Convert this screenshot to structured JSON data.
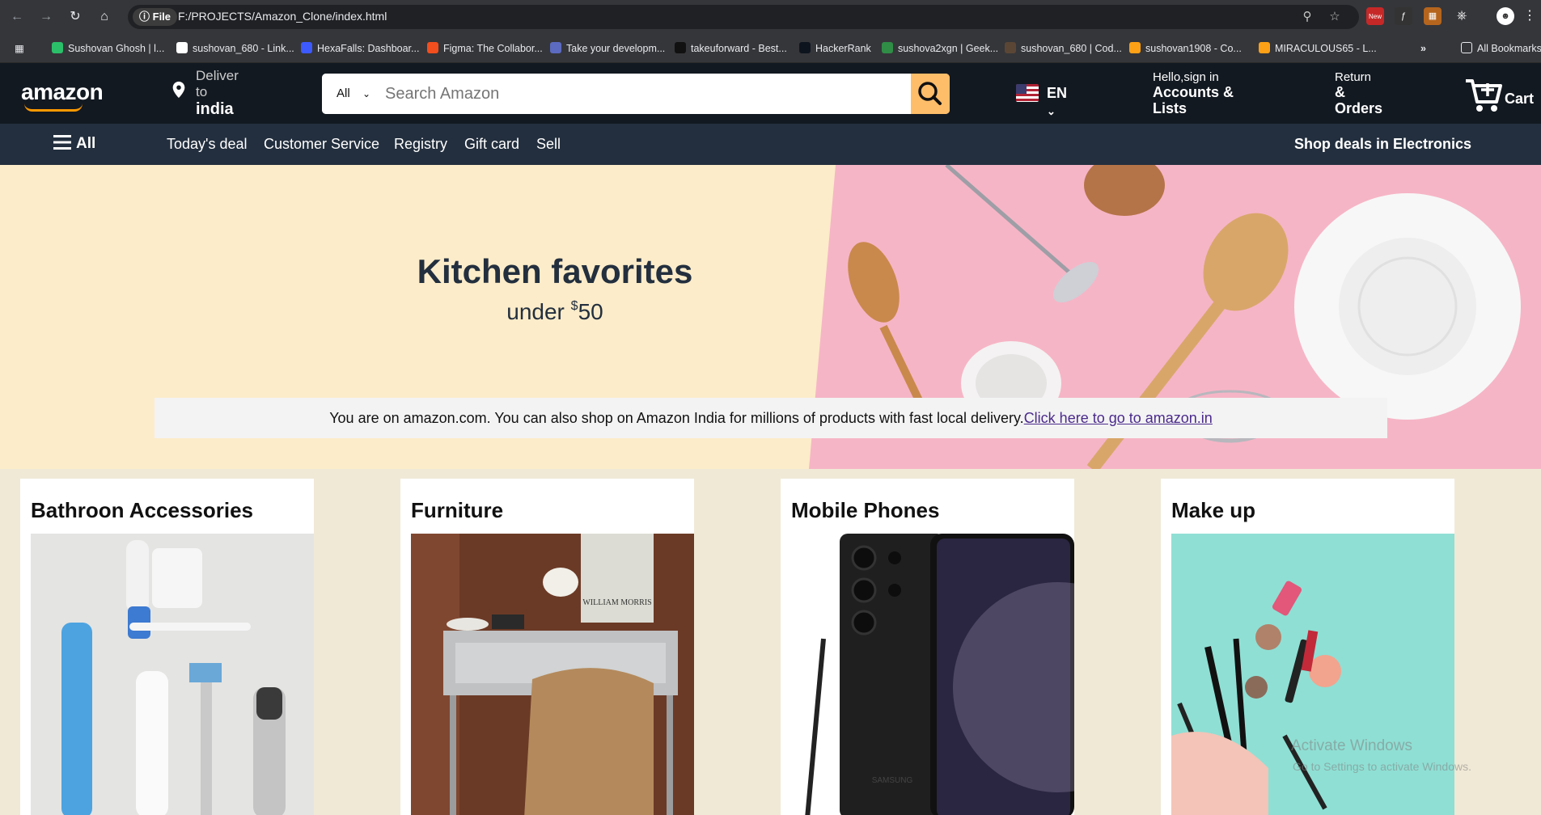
{
  "browser": {
    "file_chip": "File",
    "url": "F:/PROJECTS/Amazon_Clone/index.html",
    "bookmarks": [
      "Sushovan Ghosh | l...",
      "sushovan_680 - Link...",
      "HexaFalls: Dashboar...",
      "Figma: The Collabor...",
      "Take your developm...",
      "takeuforward - Best...",
      "HackerRank",
      "sushova2xgn | Geek...",
      "sushovan_680 | Cod...",
      "sushovan1908 - Co...",
      "MIRACULOUS65 - L..."
    ],
    "all_bookmarks": "All Bookmarks",
    "ext_badge": "New"
  },
  "header": {
    "logo": "amazon",
    "deliver_line1": "Deliver",
    "deliver_line2": "to",
    "deliver_line3": "india",
    "search_category": "All",
    "search_placeholder": "Search Amazon",
    "language": "EN",
    "account_small": "Hello,sign in",
    "account_line1": "Accounts &",
    "account_line2": "Lists",
    "orders_small": "Return",
    "orders_line1": "&",
    "orders_line2": "Orders",
    "cart": "Cart"
  },
  "nav": {
    "all": "All",
    "items": [
      "Today's deal",
      "Customer Service",
      "Registry",
      "Gift card",
      "Sell"
    ],
    "deals": "Shop deals in Electronics"
  },
  "hero": {
    "title": "Kitchen favorites",
    "sub_prefix": "under ",
    "sub_currency": "$",
    "sub_amount": "50",
    "notice_text": "You are on amazon.com. You can also shop on Amazon India for millions of products with fast local delivery.",
    "notice_link": "Click here to go to amazon.in"
  },
  "cards": [
    {
      "title": "Bathroon Accessories"
    },
    {
      "title": "Furniture"
    },
    {
      "title": "Mobile Phones"
    },
    {
      "title": "Make up"
    }
  ],
  "furniture_poster": "WILLIAM MORRIS",
  "phone_brand": "SAMSUNG",
  "watermark": {
    "line1": "Activate Windows",
    "line2": "Go to Settings to activate Windows."
  },
  "colors": {
    "header_bg": "#131921",
    "nav_bg": "#232f3e",
    "search_button": "#febd69",
    "hero_bg": "#fcecc9",
    "page_bg": "#f0e9d6"
  }
}
